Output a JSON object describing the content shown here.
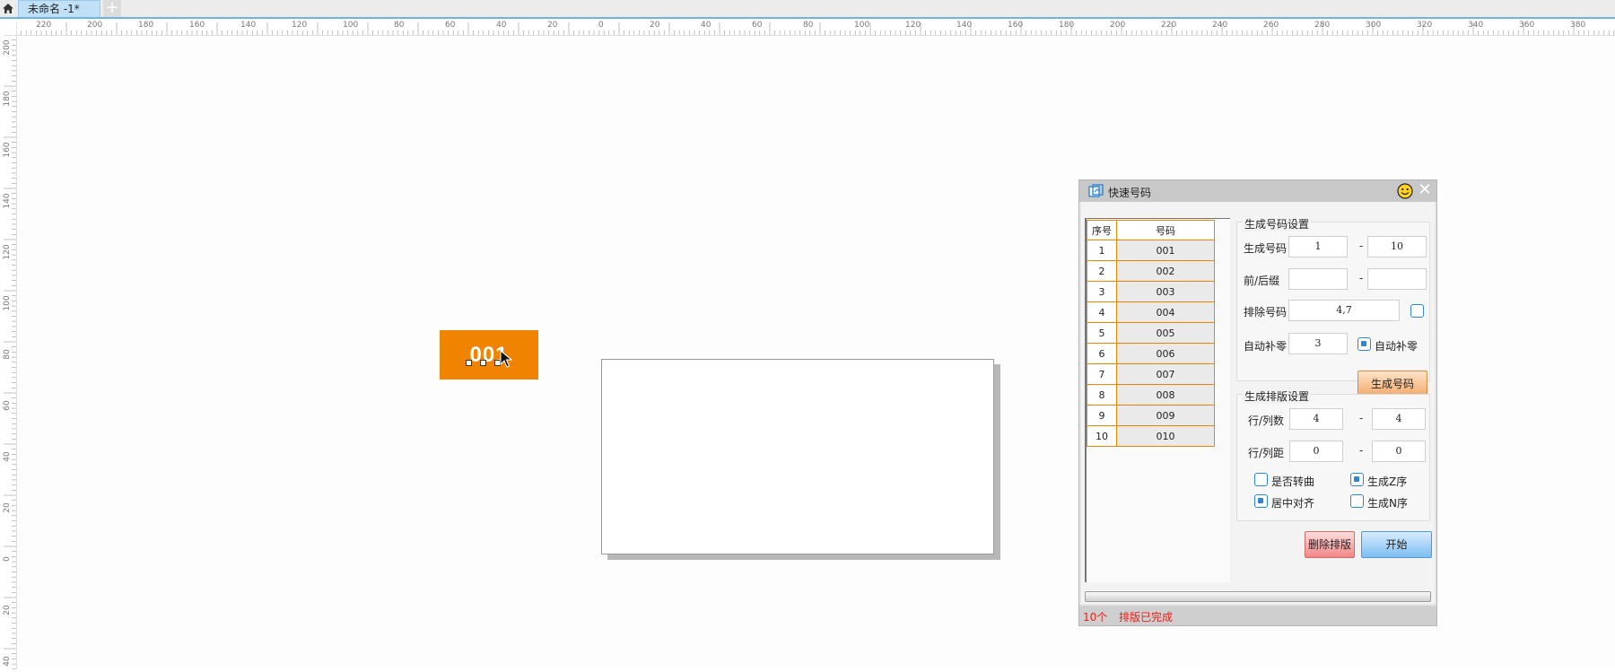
{
  "tabbar": {
    "doc_tab": "未命名 -1*",
    "add_tab": "+"
  },
  "ruler": {
    "top_labels": [
      "220",
      "200",
      "180",
      "160",
      "140",
      "120",
      "100",
      "80",
      "60",
      "40",
      "20",
      "0",
      "20",
      "40",
      "60",
      "80",
      "100",
      "120",
      "140",
      "160",
      "180",
      "200",
      "220",
      "240",
      "260",
      "280",
      "300",
      "320",
      "340",
      "360",
      "380"
    ],
    "left_labels": [
      "200",
      "180",
      "160",
      "140",
      "120",
      "100",
      "80",
      "60",
      "40",
      "20",
      "0",
      "20",
      "40"
    ]
  },
  "canvas": {
    "tag_number": "001",
    "tag_color": "#f08300"
  },
  "dialog": {
    "title": "快速号码",
    "close_glyph": "✕",
    "table": {
      "headers": [
        "序号",
        "号码"
      ],
      "rows": [
        [
          "1",
          "001"
        ],
        [
          "2",
          "002"
        ],
        [
          "3",
          "003"
        ],
        [
          "4",
          "004"
        ],
        [
          "5",
          "005"
        ],
        [
          "6",
          "006"
        ],
        [
          "7",
          "007"
        ],
        [
          "8",
          "008"
        ],
        [
          "9",
          "009"
        ],
        [
          "10",
          "010"
        ]
      ]
    },
    "gen_settings": {
      "title": "生成号码设置",
      "gen_label": "生成号码",
      "gen_from": "1",
      "gen_to": "10",
      "prefix_label": "前/后缀",
      "prefix": "",
      "suffix": "",
      "exclude_label": "排除号码",
      "exclude_value": "4,7",
      "exclude_checked": false,
      "pad_label": "自动补零",
      "pad_value": "3",
      "pad_check_label": "自动补零",
      "pad_checked": true,
      "gen_button": "生成号码",
      "range_dash": "-"
    },
    "layout_settings": {
      "title": "生成排版设置",
      "rowcol_label": "行/列数",
      "rows": "4",
      "cols": "4",
      "spacing_label": "行/列距",
      "row_spacing": "0",
      "col_spacing": "0",
      "curve_label": "是否转曲",
      "curve_checked": false,
      "z_label": "生成Z序",
      "z_checked": true,
      "center_label": "居中对齐",
      "center_checked": true,
      "n_label": "生成N序",
      "n_checked": false
    },
    "delete_button": "删除排版",
    "start_button": "开始",
    "progress": 1.0,
    "status_count": "10个",
    "status_text": "排版已完成"
  }
}
